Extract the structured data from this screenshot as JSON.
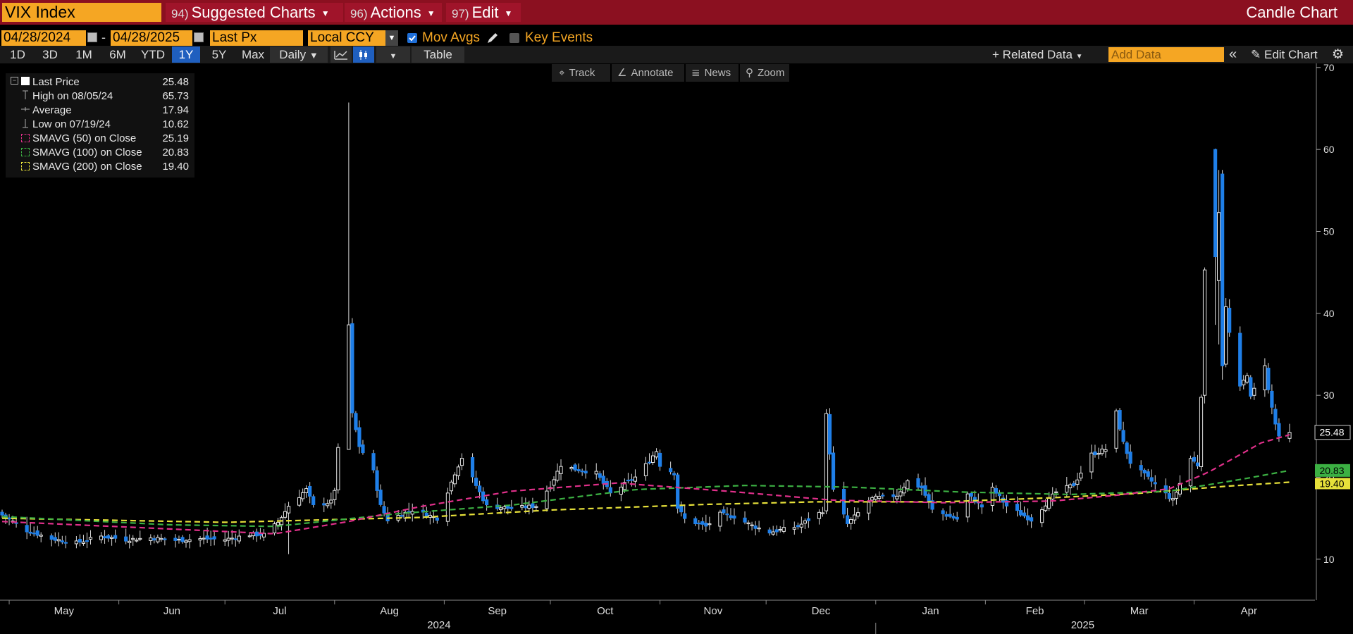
{
  "toolbar": {
    "ticker": "VIX Index",
    "menus": [
      {
        "num": "94)",
        "label": "Suggested Charts"
      },
      {
        "num": "96)",
        "label": "Actions"
      },
      {
        "num": "97)",
        "label": "Edit"
      }
    ],
    "chart_title": "Candle Chart",
    "start_date": "04/28/2024",
    "end_date": "04/28/2025",
    "range_sep": "-",
    "field": "Last Px",
    "currency": "Local CCY",
    "mov_avgs_label": "Mov Avgs",
    "mov_avgs_checked": true,
    "key_events_label": "Key Events",
    "key_events_checked": false,
    "periods": [
      "1D",
      "3D",
      "1M",
      "6M",
      "YTD",
      "1Y",
      "5Y",
      "Max"
    ],
    "active_period": "1Y",
    "frequency": "Daily",
    "table_label": "Table",
    "related_data": "Related Data",
    "add_data_placeholder": "Add Data",
    "edit_chart": "Edit Chart",
    "colors": {
      "accent": "#f5a623",
      "header": "#8b1020",
      "selected": "#1f5fbf"
    }
  },
  "chart_tools": [
    "Track",
    "Annotate",
    "News",
    "Zoom"
  ],
  "legend": [
    {
      "label": "Last Price",
      "value": "25.48",
      "icon": "white-square"
    },
    {
      "label": "High on 08/05/24",
      "value": "65.73",
      "icon": "high-marker"
    },
    {
      "label": "Average",
      "value": "17.94",
      "icon": "average-marker"
    },
    {
      "label": "Low on 07/19/24",
      "value": "10.62",
      "icon": "low-marker"
    },
    {
      "label": "SMAVG (50)  on Close",
      "value": "25.19",
      "icon": "pink-dash",
      "color": "#e0308a"
    },
    {
      "label": "SMAVG (100)  on Close",
      "value": "20.83",
      "icon": "green-dash",
      "color": "#3cb043"
    },
    {
      "label": "SMAVG (200)  on Close",
      "value": "19.40",
      "icon": "yellow-dash",
      "color": "#e6e03a"
    }
  ],
  "chart_data": {
    "type": "candlestick",
    "title": "",
    "ylim": [
      5,
      70.5
    ],
    "y_ticks": [
      10,
      20,
      30,
      40,
      50,
      60,
      70
    ],
    "y_tick_labels": [
      "10",
      "20",
      "30",
      "40",
      "50",
      "60",
      "70"
    ],
    "month_labels": [
      "May",
      "Jun",
      "Jul",
      "Aug",
      "Sep",
      "Oct",
      "Nov",
      "Dec",
      "Jan",
      "Feb",
      "Mar",
      "Apr"
    ],
    "year_labels": [
      "2024",
      "2025"
    ],
    "last_price_label": "25.48",
    "ma_labels": [
      {
        "text": "20.83",
        "color": "#3cb043"
      },
      {
        "text": "19.40",
        "color": "#e6e03a"
      }
    ],
    "close_anchors": [
      [
        "2024-04-29",
        15.4
      ],
      [
        "2024-05-06",
        13.5
      ],
      [
        "2024-05-13",
        12.5
      ],
      [
        "2024-05-20",
        12.0
      ],
      [
        "2024-05-27",
        12.8
      ],
      [
        "2024-06-03",
        12.4
      ],
      [
        "2024-06-10",
        12.6
      ],
      [
        "2024-06-17",
        12.3
      ],
      [
        "2024-06-24",
        12.5
      ],
      [
        "2024-07-01",
        12.4
      ],
      [
        "2024-07-08",
        13.0
      ],
      [
        "2024-07-12",
        13.0
      ],
      [
        "2024-07-16",
        14.5
      ],
      [
        "2024-07-19",
        16.5
      ],
      [
        "2024-07-24",
        18.5
      ],
      [
        "2024-07-26",
        16.5
      ],
      [
        "2024-07-31",
        17.0
      ],
      [
        "2024-08-01",
        18.5
      ],
      [
        "2024-08-02",
        23.4
      ],
      [
        "2024-08-05",
        38.6
      ],
      [
        "2024-08-06",
        27.7
      ],
      [
        "2024-08-08",
        23.8
      ],
      [
        "2024-08-12",
        20.7
      ],
      [
        "2024-08-14",
        16.5
      ],
      [
        "2024-08-16",
        14.8
      ],
      [
        "2024-08-23",
        16.0
      ],
      [
        "2024-08-30",
        15.0
      ],
      [
        "2024-09-04",
        20.5
      ],
      [
        "2024-09-06",
        22.4
      ],
      [
        "2024-09-10",
        19.0
      ],
      [
        "2024-09-13",
        16.5
      ],
      [
        "2024-09-20",
        16.2
      ],
      [
        "2024-09-27",
        16.5
      ],
      [
        "2024-10-01",
        19.0
      ],
      [
        "2024-10-04",
        21.5
      ],
      [
        "2024-10-08",
        21.0
      ],
      [
        "2024-10-14",
        20.5
      ],
      [
        "2024-10-18",
        18.0
      ],
      [
        "2024-10-25",
        20.0
      ],
      [
        "2024-10-28",
        21.5
      ],
      [
        "2024-10-31",
        23.2
      ],
      [
        "2024-11-01",
        21.5
      ],
      [
        "2024-11-05",
        20.5
      ],
      [
        "2024-11-06",
        16.3
      ],
      [
        "2024-11-08",
        14.9
      ],
      [
        "2024-11-14",
        14.0
      ],
      [
        "2024-11-18",
        15.5
      ],
      [
        "2024-11-22",
        15.2
      ],
      [
        "2024-11-27",
        14.1
      ],
      [
        "2024-12-02",
        13.3
      ],
      [
        "2024-12-10",
        14.0
      ],
      [
        "2024-12-17",
        15.9
      ],
      [
        "2024-12-18",
        27.6
      ],
      [
        "2024-12-20",
        18.4
      ],
      [
        "2024-12-24",
        14.3
      ],
      [
        "2024-12-31",
        17.4
      ],
      [
        "2025-01-07",
        17.8
      ],
      [
        "2025-01-10",
        19.5
      ],
      [
        "2025-01-14",
        18.7
      ],
      [
        "2025-01-17",
        16.0
      ],
      [
        "2025-01-24",
        14.9
      ],
      [
        "2025-01-27",
        17.9
      ],
      [
        "2025-01-31",
        16.4
      ],
      [
        "2025-02-03",
        18.6
      ],
      [
        "2025-02-07",
        16.5
      ],
      [
        "2025-02-14",
        14.8
      ],
      [
        "2025-02-21",
        18.2
      ],
      [
        "2025-02-26",
        19.1
      ],
      [
        "2025-03-03",
        22.8
      ],
      [
        "2025-03-07",
        23.4
      ],
      [
        "2025-03-10",
        27.9
      ],
      [
        "2025-03-12",
        24.2
      ],
      [
        "2025-03-14",
        21.8
      ],
      [
        "2025-03-19",
        19.9
      ],
      [
        "2025-03-26",
        17.2
      ],
      [
        "2025-03-31",
        22.3
      ],
      [
        "2025-04-02",
        21.5
      ],
      [
        "2025-04-03",
        30.0
      ],
      [
        "2025-04-04",
        45.3
      ],
      [
        "2025-04-07",
        46.9
      ],
      [
        "2025-04-08",
        52.3
      ],
      [
        "2025-04-09",
        33.6
      ],
      [
        "2025-04-10",
        40.7
      ],
      [
        "2025-04-11",
        37.6
      ],
      [
        "2025-04-14",
        30.9
      ],
      [
        "2025-04-16",
        32.6
      ],
      [
        "2025-04-17",
        29.7
      ],
      [
        "2025-04-21",
        33.8
      ],
      [
        "2025-04-22",
        30.6
      ],
      [
        "2025-04-23",
        28.5
      ],
      [
        "2025-04-24",
        26.5
      ],
      [
        "2025-04-25",
        24.8
      ],
      [
        "2025-04-28",
        25.48
      ]
    ],
    "sma_50": [
      [
        "2024-04-29",
        14.6
      ],
      [
        "2024-06-15",
        13.7
      ],
      [
        "2024-07-15",
        13.1
      ],
      [
        "2024-08-05",
        14.6
      ],
      [
        "2024-08-25",
        16.4
      ],
      [
        "2024-09-20",
        18.3
      ],
      [
        "2024-10-20",
        19.3
      ],
      [
        "2024-11-20",
        18.3
      ],
      [
        "2024-12-20",
        17.2
      ],
      [
        "2025-01-20",
        16.9
      ],
      [
        "2025-02-20",
        17.1
      ],
      [
        "2025-03-10",
        17.8
      ],
      [
        "2025-03-25",
        18.6
      ],
      [
        "2025-04-05",
        20.6
      ],
      [
        "2025-04-20",
        24.2
      ],
      [
        "2025-04-28",
        25.19
      ]
    ],
    "sma_100": [
      [
        "2024-04-29",
        15.2
      ],
      [
        "2024-06-15",
        14.2
      ],
      [
        "2024-07-15",
        14.0
      ],
      [
        "2024-08-20",
        15.6
      ],
      [
        "2024-09-20",
        16.6
      ],
      [
        "2024-10-25",
        18.5
      ],
      [
        "2024-11-25",
        19.0
      ],
      [
        "2024-12-25",
        18.8
      ],
      [
        "2025-01-25",
        18.2
      ],
      [
        "2025-02-25",
        17.9
      ],
      [
        "2025-03-25",
        18.3
      ],
      [
        "2025-04-15",
        19.8
      ],
      [
        "2025-04-28",
        20.83
      ]
    ],
    "sma_200": [
      [
        "2024-04-29",
        15.0
      ],
      [
        "2024-07-01",
        14.5
      ],
      [
        "2024-08-25",
        15.1
      ],
      [
        "2024-10-01",
        16.0
      ],
      [
        "2024-11-15",
        16.7
      ],
      [
        "2024-12-15",
        17.0
      ],
      [
        "2025-01-20",
        17.0
      ],
      [
        "2025-02-20",
        17.5
      ],
      [
        "2025-03-15",
        18.0
      ],
      [
        "2025-04-10",
        18.9
      ],
      [
        "2025-04-28",
        19.4
      ]
    ]
  }
}
